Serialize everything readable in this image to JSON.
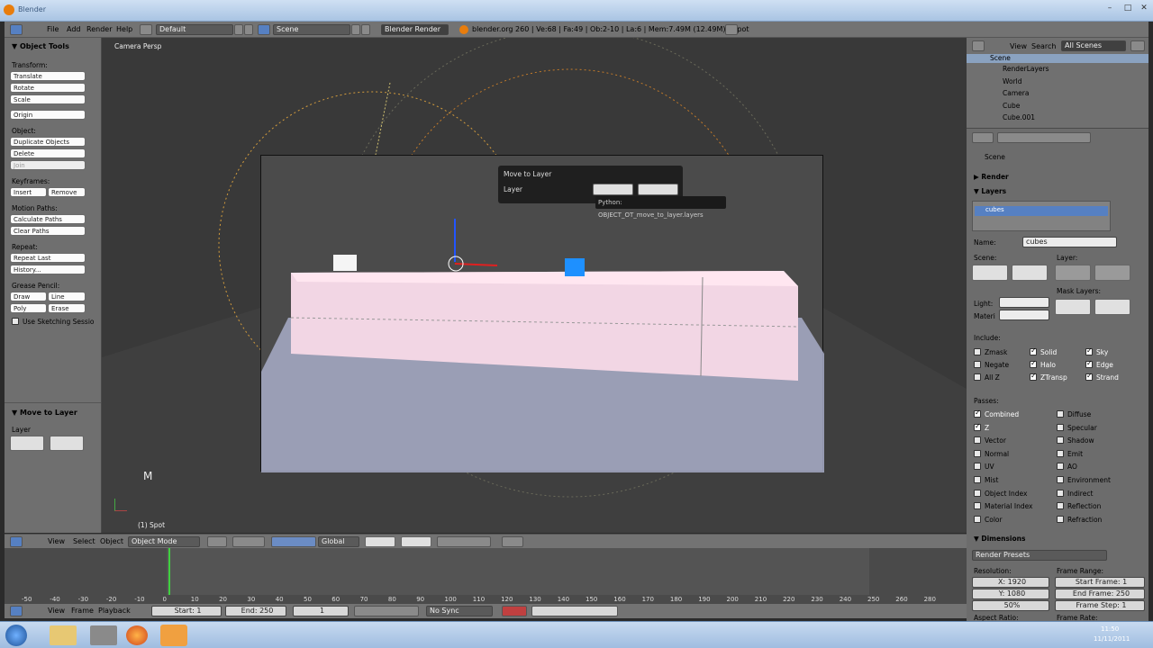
{
  "window": {
    "title": "Blender"
  },
  "topbar": {
    "menus": [
      "File",
      "Add",
      "Render",
      "Help"
    ],
    "layout": "Default",
    "scene": "Scene",
    "engine": "Blender Render",
    "stats": "blender.org 260 | Ve:68 | Fa:49 | Ob:2-10 | La:6 | Mem:7.49M (12.49M) | Spot"
  },
  "toolshelf": {
    "title": "Object Tools",
    "transform_label": "Transform:",
    "translate": "Translate",
    "rotate": "Rotate",
    "scale": "Scale",
    "origin": "Origin",
    "object_label": "Object:",
    "duplicate": "Duplicate Objects",
    "delete": "Delete",
    "join": "Join",
    "keyframes_label": "Keyframes:",
    "insert": "Insert",
    "remove": "Remove",
    "motion_label": "Motion Paths:",
    "calc_paths": "Calculate Paths",
    "clear_paths": "Clear Paths",
    "repeat_label": "Repeat:",
    "repeat_last": "Repeat Last",
    "history": "History...",
    "grease_label": "Grease Pencil:",
    "draw": "Draw",
    "line": "Line",
    "poly": "Poly",
    "erase": "Erase",
    "sketch": "Use Sketching Sessio",
    "op_title": "Move to Layer",
    "op_layer": "Layer"
  },
  "viewport": {
    "label": "Camera Persp",
    "object_info": "(1) Spot",
    "key_hint": "M"
  },
  "popup": {
    "title": "Move to Layer",
    "layer": "Layer",
    "tooltip": "Python: OBJECT_OT_move_to_layer.layers"
  },
  "view_header": {
    "view": "View",
    "select": "Select",
    "object": "Object",
    "mode": "Object Mode",
    "orientation": "Global"
  },
  "timeline": {
    "ticks": [
      "-50",
      "-40",
      "-30",
      "-20",
      "-10",
      "0",
      "10",
      "20",
      "30",
      "40",
      "50",
      "60",
      "70",
      "80",
      "90",
      "100",
      "110",
      "120",
      "130",
      "140",
      "150",
      "160",
      "170",
      "180",
      "190",
      "200",
      "210",
      "220",
      "230",
      "240",
      "250",
      "260",
      "280"
    ],
    "current_frame": "1"
  },
  "timeline_header": {
    "view": "View",
    "frame": "Frame",
    "playback": "Playback",
    "start": "Start: 1",
    "end": "End: 250",
    "current": "1",
    "sync": "No Sync"
  },
  "outliner": {
    "view": "View",
    "search": "Search",
    "filter": "All Scenes",
    "items": [
      "Scene",
      "RenderLayers",
      "World",
      "Camera",
      "Cube",
      "Cube.001"
    ]
  },
  "properties": {
    "scene": "Scene",
    "render": "Render",
    "layers": "Layers",
    "layer_item": "cubes",
    "name_label": "Name:",
    "name_value": "cubes",
    "scene_label": "Scene:",
    "layer_label": "Layer:",
    "mask_label": "Mask Layers:",
    "light": "Light:",
    "materi": "Materi",
    "include": "Include:",
    "include_items": [
      [
        "Zmask",
        "Solid",
        "Sky"
      ],
      [
        "Negate",
        "Halo",
        "Edge"
      ],
      [
        "All Z",
        "ZTransp",
        "Strand"
      ]
    ],
    "passes": "Passes:",
    "passes_left": [
      "Combined",
      "Z",
      "Vector",
      "Normal",
      "UV",
      "Mist",
      "Object Index",
      "Material Index",
      "Color"
    ],
    "passes_right": [
      "Diffuse",
      "Specular",
      "Shadow",
      "Emit",
      "AO",
      "Environment",
      "Indirect",
      "Reflection",
      "Refraction"
    ],
    "dimensions": "Dimensions",
    "render_presets": "Render Presets",
    "resolution": "Resolution:",
    "res_x": "X: 1920",
    "res_y": "Y: 1080",
    "res_pct": "50%",
    "frame_range": "Frame Range:",
    "start_frame": "Start Frame: 1",
    "end_frame": "End Frame: 250",
    "frame_step": "Frame Step: 1",
    "aspect": "Aspect Ratio:",
    "frame_rate": "Frame Rate:"
  },
  "taskbar": {
    "time": "11:50",
    "date": "11/11/2011"
  },
  "colors": {
    "accent": "#5680c2",
    "selection": "#ffa040",
    "header": "#737373"
  }
}
